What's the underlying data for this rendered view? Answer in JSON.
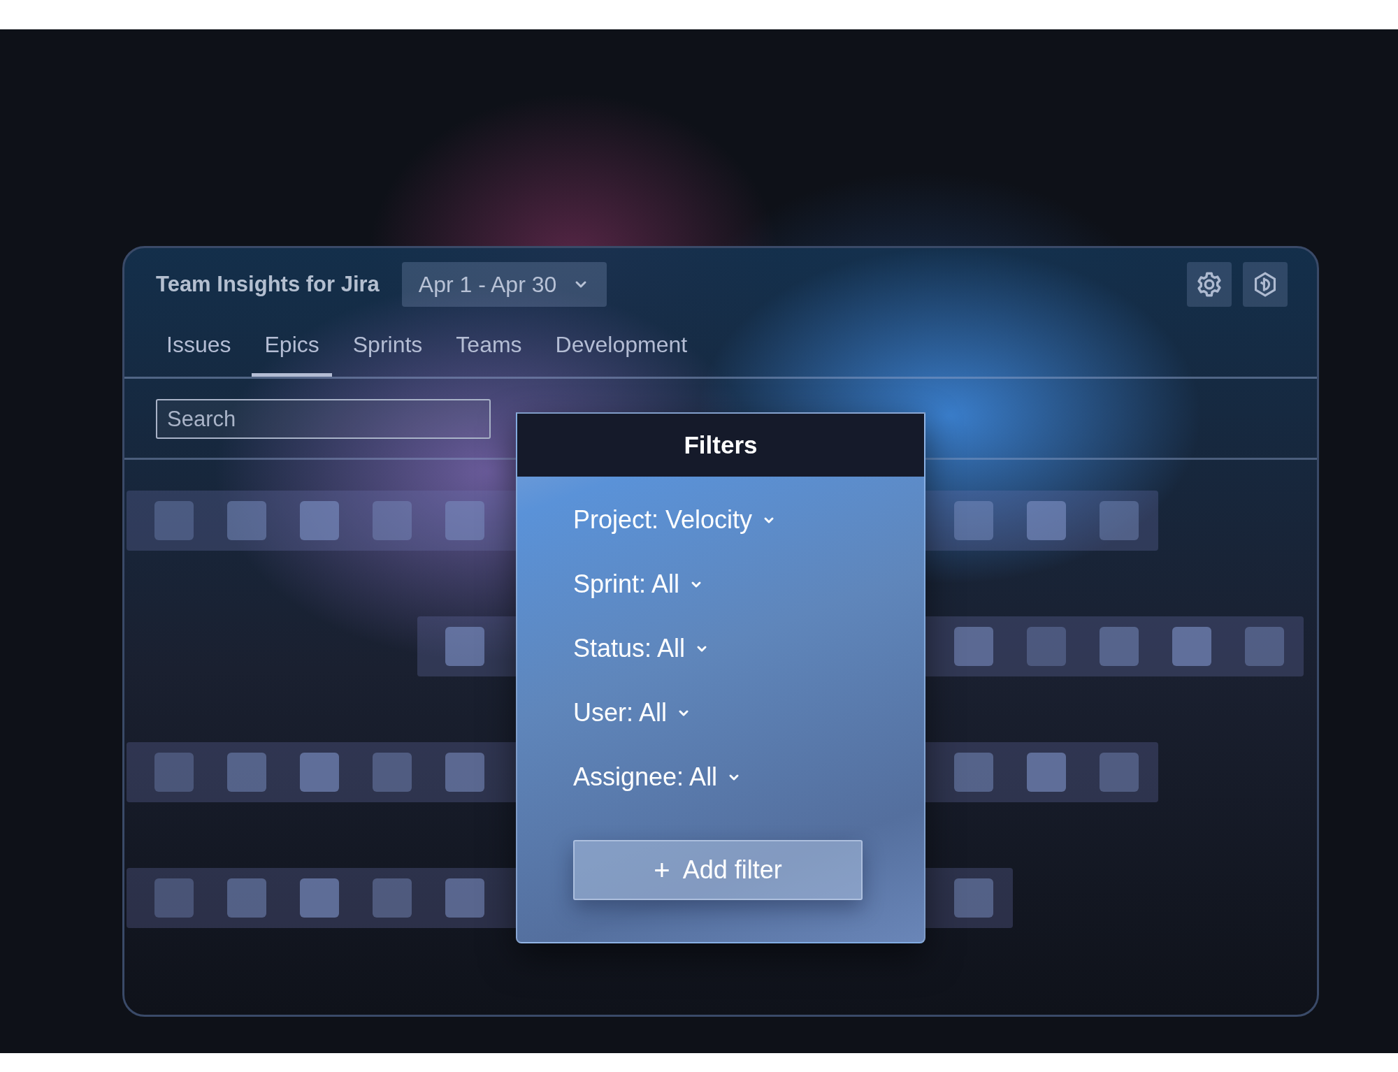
{
  "app_title": "Team Insights for Jira",
  "date_range": {
    "value": "Apr 1 - Apr 30"
  },
  "tabs": [
    {
      "label": "Issues",
      "selected": false
    },
    {
      "label": "Epics",
      "selected": true
    },
    {
      "label": "Sprints",
      "selected": false
    },
    {
      "label": "Teams",
      "selected": false
    },
    {
      "label": "Development",
      "selected": false
    }
  ],
  "search": {
    "placeholder": "Search"
  },
  "filters_popup": {
    "title": "Filters",
    "filters": [
      {
        "label": "Project: Velocity"
      },
      {
        "label": "Sprint: All"
      },
      {
        "label": "Status: All"
      },
      {
        "label": "User: All"
      },
      {
        "label": "Assignee: All"
      }
    ],
    "add_button": {
      "icon": "+",
      "label": "Add filter"
    }
  }
}
